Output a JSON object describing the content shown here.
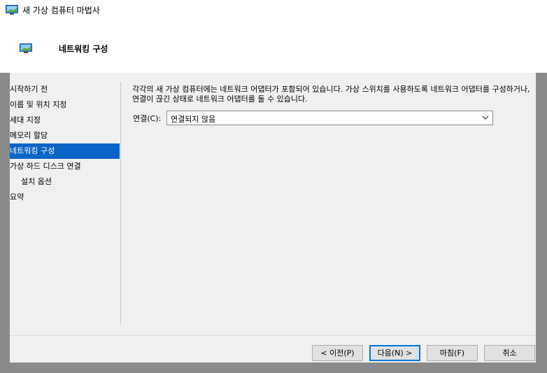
{
  "window": {
    "title": "새 가상 컴퓨터 마법사"
  },
  "header": {
    "title": "네트워킹 구성"
  },
  "nav": {
    "items": [
      {
        "label": "시작하기 전",
        "indent": false,
        "selected": false
      },
      {
        "label": "이름 및 위치 지정",
        "indent": false,
        "selected": false
      },
      {
        "label": "세대 지정",
        "indent": false,
        "selected": false
      },
      {
        "label": "메모리 할당",
        "indent": false,
        "selected": false
      },
      {
        "label": "네트워킹 구성",
        "indent": false,
        "selected": true
      },
      {
        "label": "가상 하드 디스크 연결",
        "indent": false,
        "selected": false
      },
      {
        "label": "설치 옵션",
        "indent": true,
        "selected": false
      },
      {
        "label": "요약",
        "indent": false,
        "selected": false
      }
    ]
  },
  "content": {
    "description": "각각의 새 가상 컴퓨터에는 네트워크 어댑터가 포함되어 있습니다. 가상 스위치를 사용하도록 네트워크 어댑터를 구성하거나, 연결이 끊긴 상태로 네트워크 어댑터를 둘 수 있습니다.",
    "connection_label": "연결(C):",
    "connection_value": "연결되지 않음"
  },
  "buttons": {
    "prev": "< 이전(P)",
    "next": "다음(N) >",
    "finish": "마침(F)",
    "cancel": "취소"
  },
  "colors": {
    "selected_bg": "#0a64c8",
    "accent": "#0078d7"
  }
}
